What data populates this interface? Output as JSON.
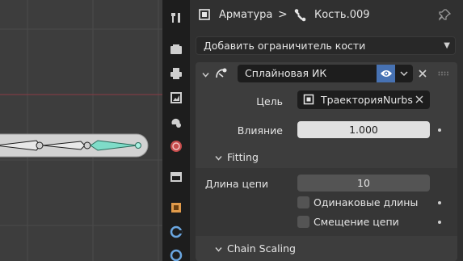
{
  "header": {
    "object_name": "Арматура",
    "separator": ">",
    "bone_name": "Кость.009"
  },
  "add_constraint": {
    "label": "Добавить ограничитель кости"
  },
  "constraint": {
    "name": "Сплайновая ИК",
    "target_label": "Цель",
    "target_value": "ТраекторияNurbs",
    "influence_label": "Влияние",
    "influence_value": "1.000",
    "fitting": {
      "title": "Fitting",
      "chain_length_label": "Длина цепи",
      "chain_length_value": "10",
      "even_divisions_label": "Одинаковые длины",
      "chain_offset_label": "Смещение цепи"
    },
    "chain_scaling": {
      "title": "Chain Scaling"
    }
  },
  "colors": {
    "accent": "#4772b3",
    "panel_bg": "#3d3d3d",
    "editor_bg": "#303030",
    "field_bg": "#545454",
    "bone_selected": "#7fdcc8"
  }
}
